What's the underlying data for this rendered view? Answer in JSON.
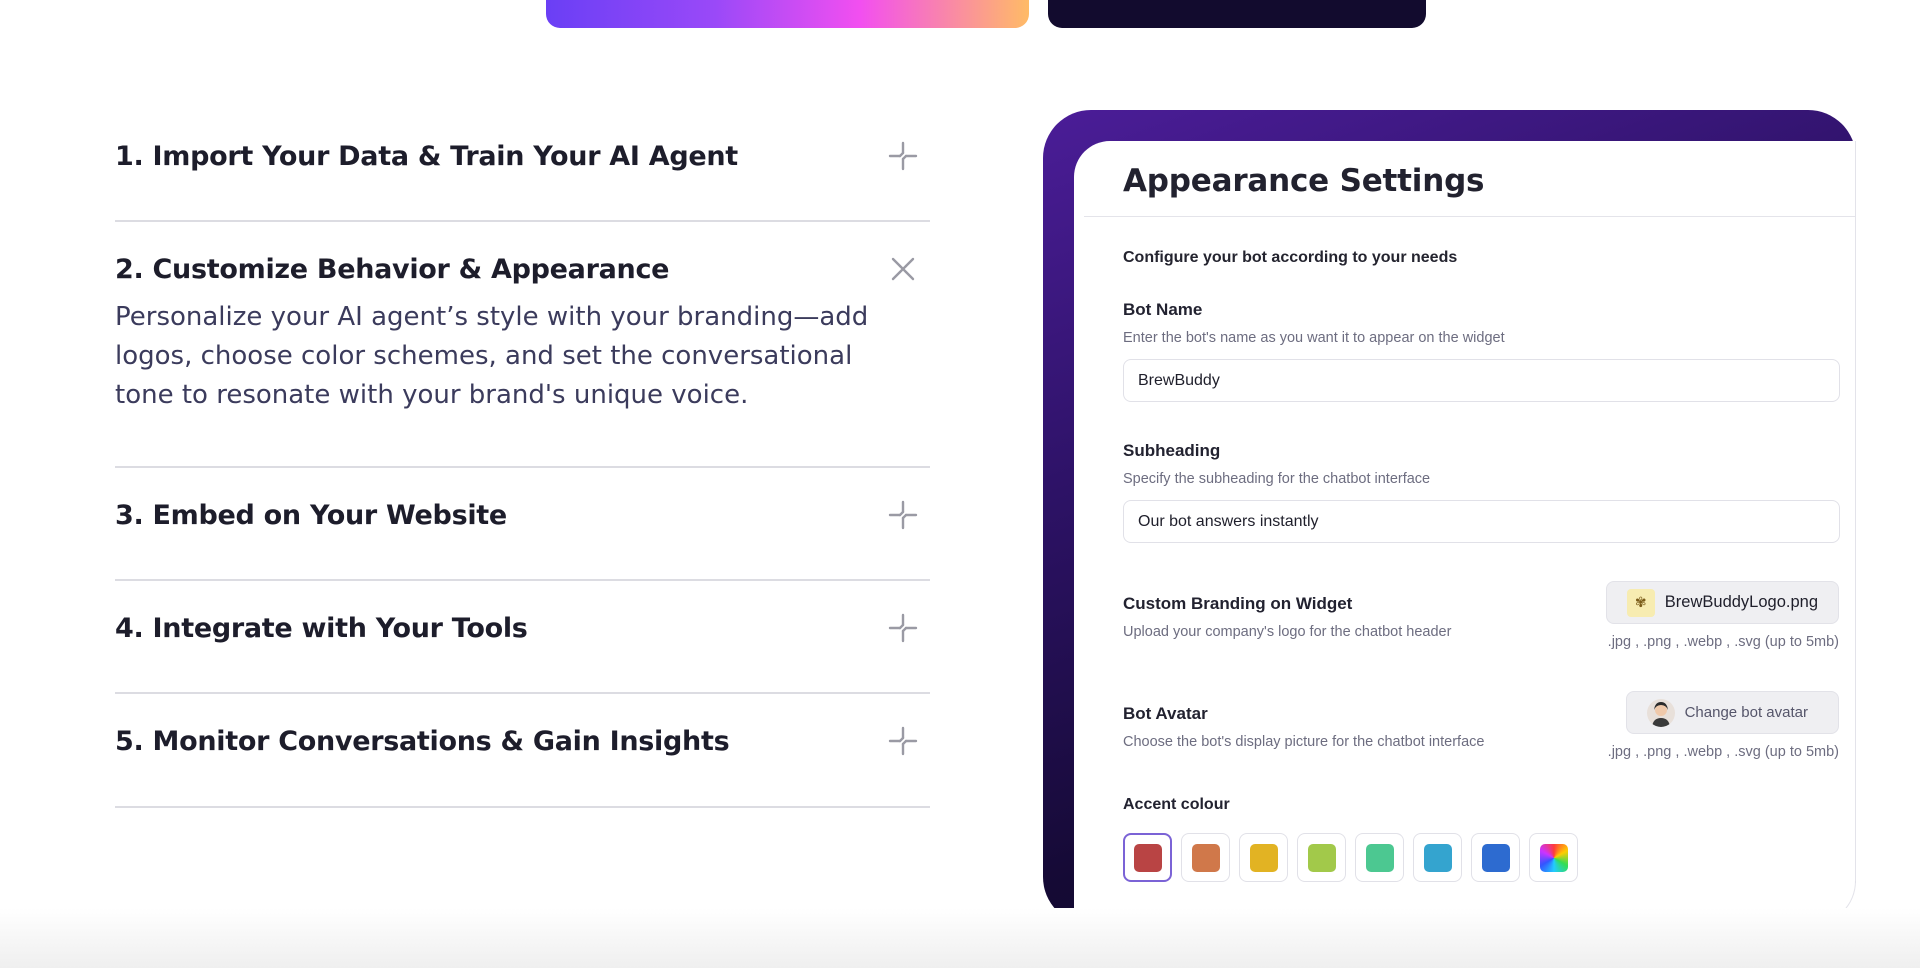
{
  "accordion": {
    "items": [
      {
        "title": "1. Import Your Data & Train Your AI Agent",
        "expanded": false,
        "icon": "plus-sparkle-icon"
      },
      {
        "title": "2. Customize Behavior & Appearance",
        "expanded": true,
        "icon": "close-icon",
        "body": "Personalize your AI agent’s style with your branding—add logos, choose color schemes, and set the conversational tone to resonate with your brand's unique voice."
      },
      {
        "title": "3. Embed on Your Website",
        "expanded": false,
        "icon": "plus-sparkle-icon"
      },
      {
        "title": "4. Integrate with Your Tools",
        "expanded": false,
        "icon": "plus-sparkle-icon"
      },
      {
        "title": "5. Monitor Conversations & Gain Insights",
        "expanded": false,
        "icon": "plus-sparkle-icon"
      }
    ]
  },
  "settings": {
    "title": "Appearance Settings",
    "subtitle": "Configure your bot according to your needs",
    "bot_name": {
      "label": "Bot Name",
      "hint": "Enter the bot's name as you want it to appear on the widget",
      "value": "BrewBuddy"
    },
    "subheading": {
      "label": "Subheading",
      "hint": "Specify the subheading for the chatbot interface",
      "value": "Our bot answers instantly"
    },
    "branding": {
      "label": "Custom Branding on Widget",
      "hint": "Upload your company's logo for the chatbot header",
      "button": "BrewBuddyLogo.png",
      "note": ".jpg , .png , .webp , .svg (up to 5mb)"
    },
    "avatar": {
      "label": "Bot Avatar",
      "hint": "Choose the bot's display picture for the chatbot interface",
      "button": "Change bot avatar",
      "note": ".jpg , .png , .webp , .svg (up to 5mb)"
    },
    "accent": {
      "label": "Accent colour",
      "colors": [
        "#b94444",
        "#d0784a",
        "#e2b323",
        "#a2c94a",
        "#4cc891",
        "#34a4cf",
        "#2d6bd0",
        "rainbow"
      ],
      "selected_index": 0
    }
  },
  "colors": {
    "gradient_button": [
      "#6a3ff5",
      "#f24ff0",
      "#ffbb66"
    ],
    "dark_button": "#120b2e",
    "card_frame": "#2d1266"
  }
}
